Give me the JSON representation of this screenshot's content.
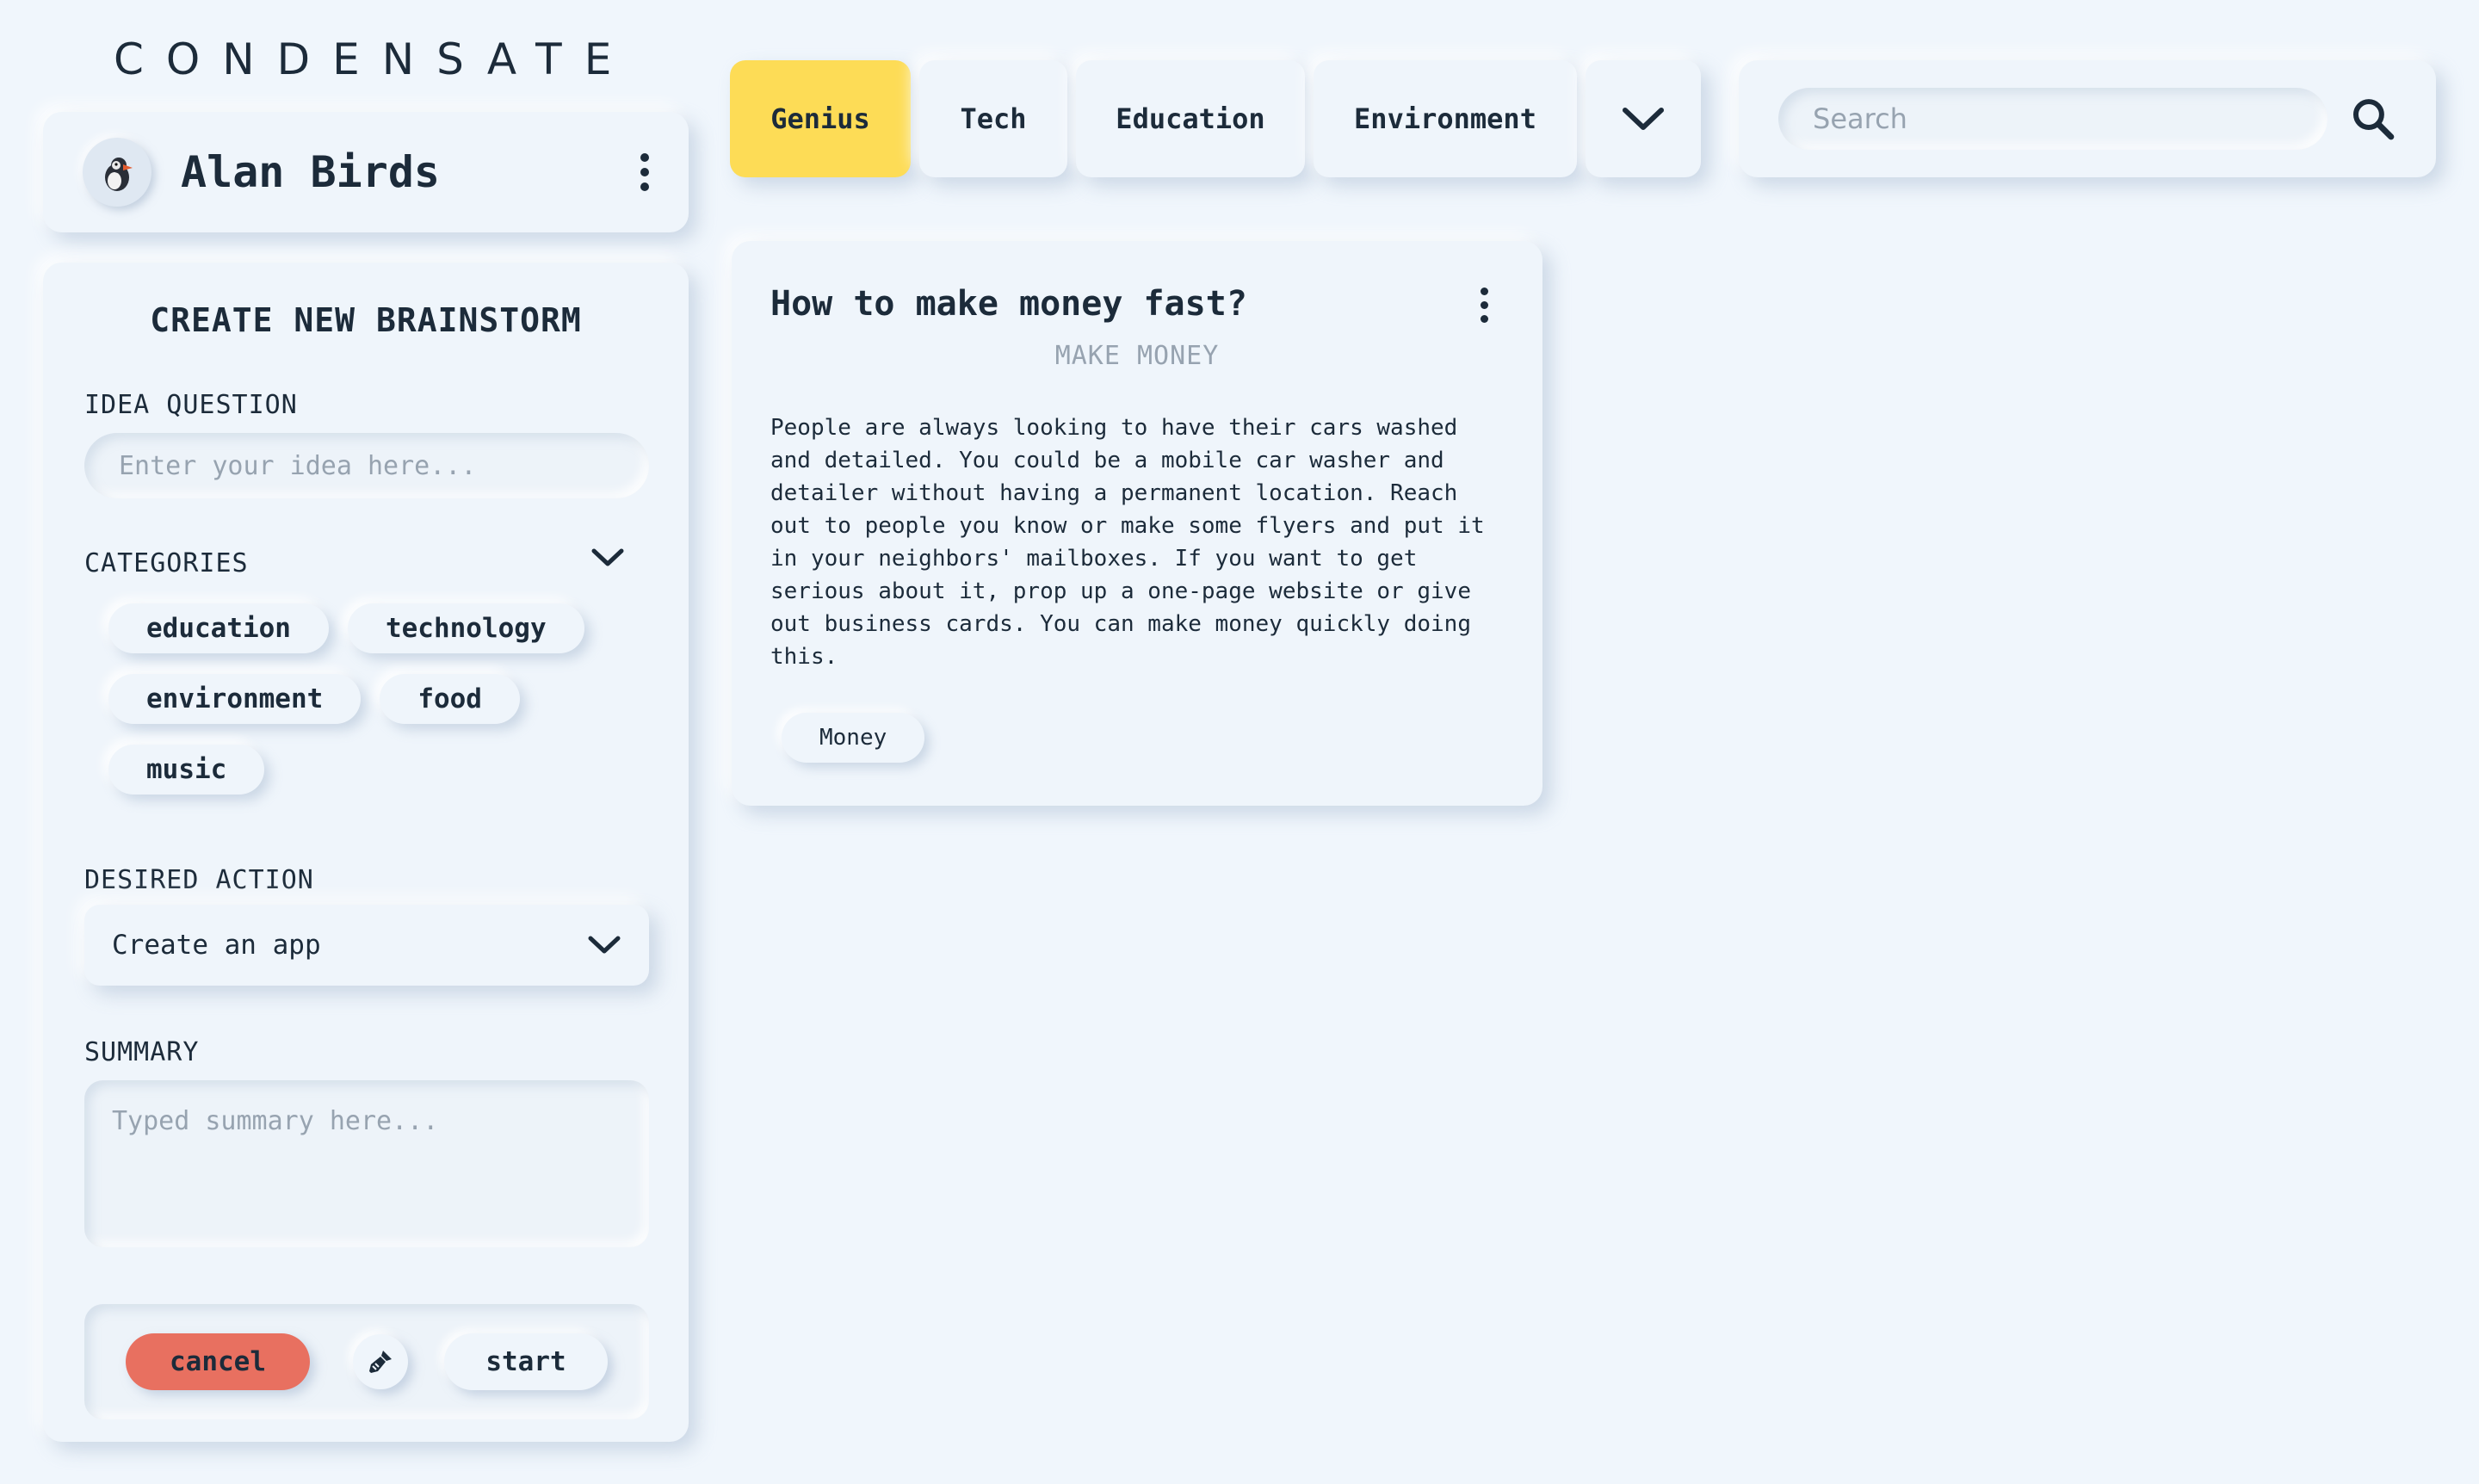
{
  "app": {
    "logo": "CONDENSATE"
  },
  "profile": {
    "name": "Alan Birds",
    "avatar_icon": "puffin-avatar",
    "menu_icon": "kebab-menu-icon"
  },
  "brainstorm": {
    "title": "CREATE NEW BRAINSTORM",
    "idea_label": "IDEA QUESTION",
    "idea_placeholder": "Enter your idea here...",
    "idea_value": "",
    "categories_label": "CATEGORIES",
    "categories": [
      "education",
      "technology",
      "environment",
      "food",
      "music"
    ],
    "action_label": "DESIRED ACTION",
    "action_selected": "Create an app",
    "summary_label": "SUMMARY",
    "summary_placeholder": "Typed summary here...",
    "buttons": {
      "cancel": "cancel",
      "start": "start"
    },
    "colors": {
      "cancel": "#e87060"
    }
  },
  "tabs": {
    "items": [
      "Genius",
      "Tech",
      "Education",
      "Environment"
    ],
    "active": "Genius",
    "active_color": "#fddc56"
  },
  "search": {
    "placeholder": "Search",
    "value": ""
  },
  "card": {
    "title": "How to make money fast?",
    "subtitle": "MAKE MONEY",
    "body": "People are always looking to have their cars washed and detailed. You could be a mobile car washer and detailer without having a permanent location. Reach out to people you know or make some flyers and put it in your neighbors' mailboxes. If you want to get serious about it, prop up a one-page website or give out business cards. You can make money quickly doing this.",
    "tag": "Money"
  }
}
